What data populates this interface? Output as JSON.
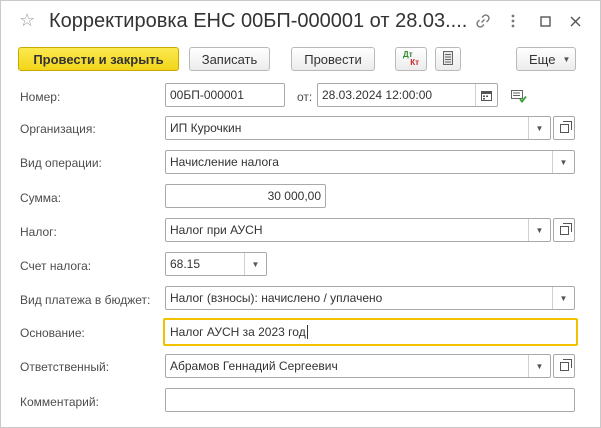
{
  "window": {
    "title": "Корректировка ЕНС 00БП-000001 от 28.03...."
  },
  "toolbar": {
    "post_close": "Провести и закрыть",
    "save": "Записать",
    "post": "Провести",
    "dtkt_dt": "Дт",
    "dtkt_kt": "Кт",
    "more": "Еще"
  },
  "form": {
    "number_label": "Номер:",
    "number_value": "00БП-000001",
    "date_label": "от:",
    "date_value": "28.03.2024 12:00:00",
    "org_label": "Организация:",
    "org_value": "ИП Курочкин",
    "operation_label": "Вид операции:",
    "operation_value": "Начисление налога",
    "sum_label": "Сумма:",
    "sum_value": "30 000,00",
    "tax_label": "Налог:",
    "tax_value": "Налог при АУСН",
    "account_label": "Счет налога:",
    "account_value": "68.15",
    "payment_label": "Вид платежа в бюджет:",
    "payment_value": "Налог (взносы): начислено / уплачено",
    "basis_label": "Основание:",
    "basis_value": "Налог АУСН за 2023 год",
    "responsible_label": "Ответственный:",
    "responsible_value": "Абрамов Геннадий Сергеевич",
    "comment_label": "Комментарий:",
    "comment_value": ""
  },
  "colors": {
    "primary_button": "#f2d51a",
    "focus_border": "#f2c200",
    "dt_color": "#2e8b2e",
    "kt_color": "#cc2222"
  }
}
